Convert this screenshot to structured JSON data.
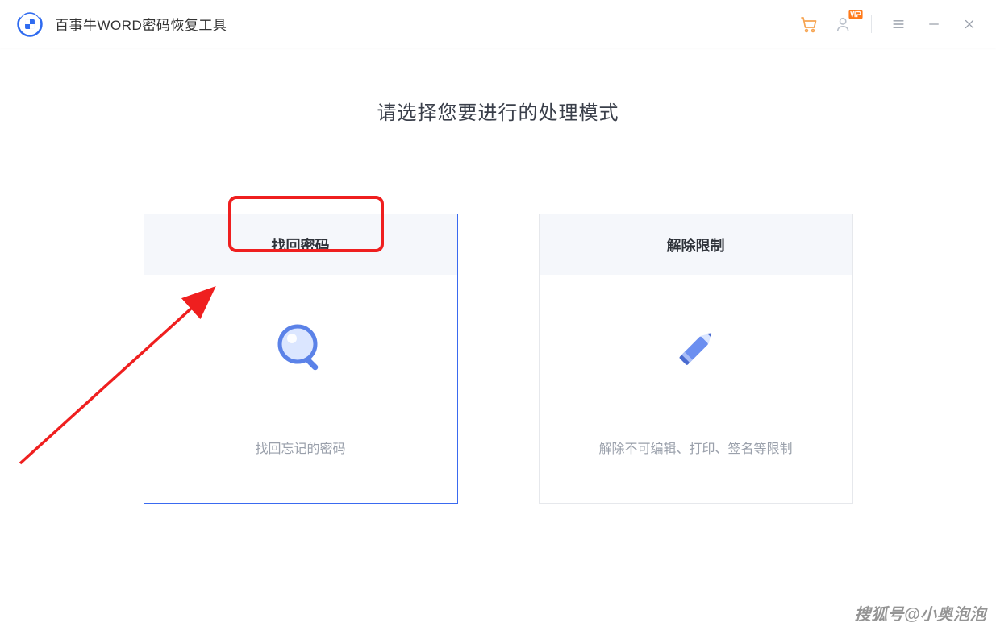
{
  "app": {
    "title": "百事牛WORD密码恢复工具"
  },
  "main": {
    "heading": "请选择您要进行的处理模式"
  },
  "cards": [
    {
      "title": "找回密码",
      "desc": "找回忘记的密码"
    },
    {
      "title": "解除限制",
      "desc": "解除不可编辑、打印、签名等限制"
    }
  ],
  "watermark": "搜狐号@小奥泡泡",
  "colors": {
    "accent": "#3a6af0",
    "highlight": "#ef1f1f",
    "icon_orange": "#f6a451",
    "icon_blue": "#6c8ff0"
  }
}
